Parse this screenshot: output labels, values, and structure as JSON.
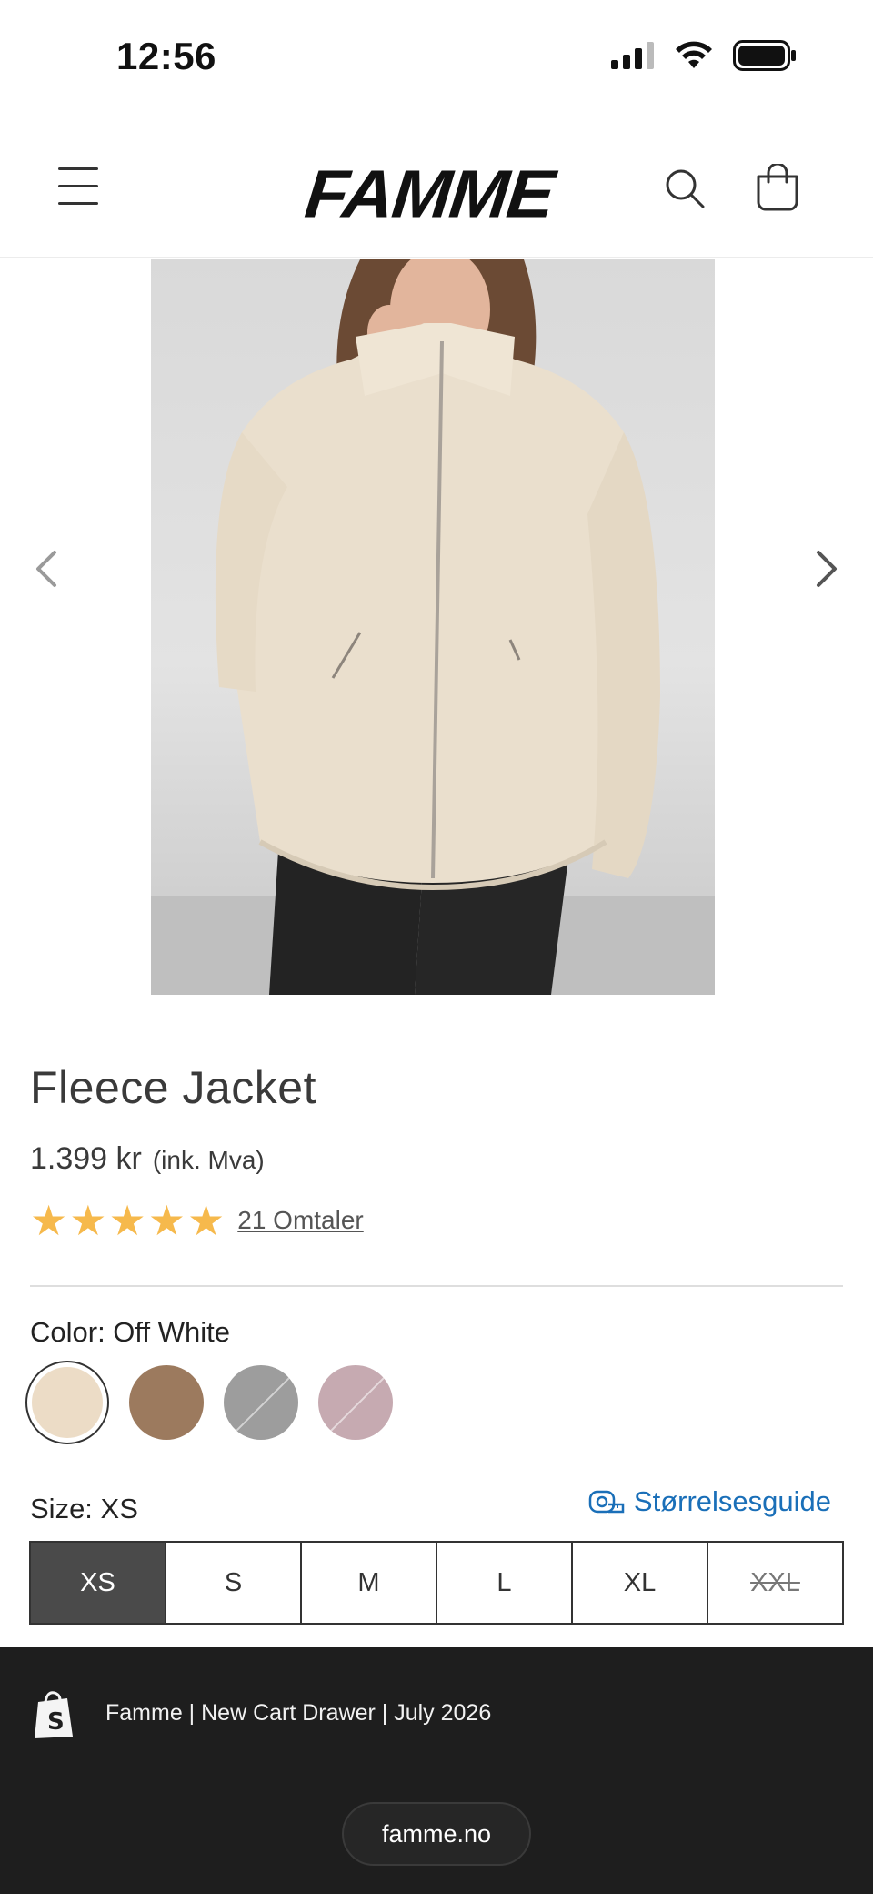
{
  "status_bar": {
    "time": "12:56"
  },
  "header": {
    "logo": "FAMME",
    "icons": [
      "menu-icon",
      "search-icon",
      "cart-icon"
    ]
  },
  "gallery": {
    "image_alt": "Woman wearing off-white fleece jacket",
    "prev_icon": "chevron-left-icon",
    "next_icon": "chevron-right-icon"
  },
  "product": {
    "title": "Fleece Jacket",
    "price": "1.399 kr",
    "vat_note": "(ink. Mva)",
    "rating_stars": 5,
    "reviews_label": "21 Omtaler",
    "color_label": "Color: Off White",
    "colors": [
      {
        "name": "Off White",
        "hex": "#ecdcc6",
        "selected": true
      },
      {
        "name": "Brown",
        "hex": "#9c7a5e",
        "selected": false
      },
      {
        "name": "Grey",
        "hex": "#9d9d9d",
        "selected": false
      },
      {
        "name": "Pink",
        "hex": "#c6aab1",
        "selected": false
      }
    ],
    "size_label": "Size: XS",
    "size_guide_label": "Størrelsesguide",
    "sizes": [
      {
        "label": "XS",
        "selected": true,
        "available": true
      },
      {
        "label": "S",
        "selected": false,
        "available": true
      },
      {
        "label": "M",
        "selected": false,
        "available": true
      },
      {
        "label": "L",
        "selected": false,
        "available": true
      },
      {
        "label": "XL",
        "selected": false,
        "available": true
      },
      {
        "label": "XXL",
        "selected": false,
        "available": false
      }
    ]
  },
  "preview_bar": {
    "text": "Famme | New Cart Drawer | July 2026",
    "domain": "famme.no"
  },
  "colors": {
    "accent_link": "#1a6fb8",
    "star": "#f6b94c",
    "selected_size_bg": "#4a4a4a",
    "footer_bg": "#1e1e1e"
  }
}
